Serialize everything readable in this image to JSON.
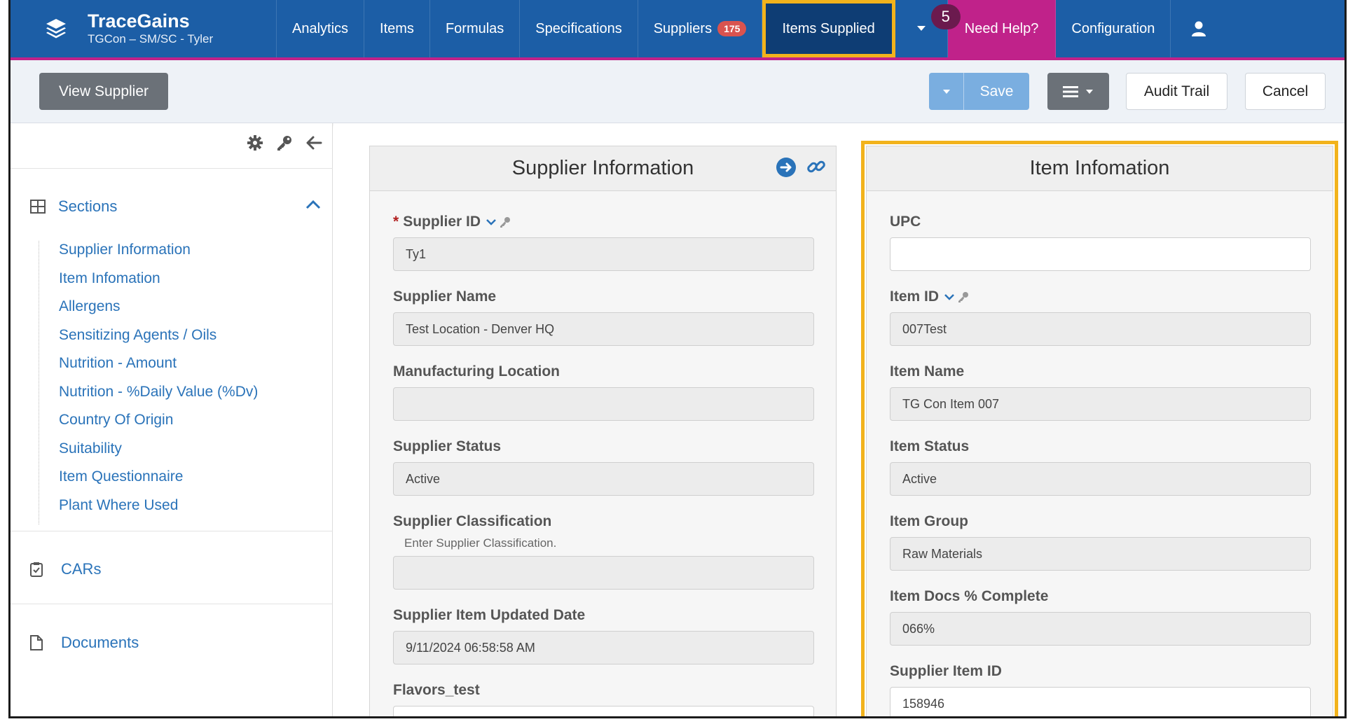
{
  "nav": {
    "brand_title": "TraceGains",
    "brand_sub": "TGCon – SM/SC - Tyler",
    "items": [
      "Analytics",
      "Items",
      "Formulas",
      "Specifications"
    ],
    "suppliers_label": "Suppliers",
    "suppliers_badge": "175",
    "active_label": "Items Supplied",
    "help_label": "Need Help?",
    "help_count": "5",
    "config_label": "Configuration",
    "accent": "#c0228a",
    "brand_color": "#1c5ea6"
  },
  "toolbar": {
    "view_supplier": "View Supplier",
    "save": "Save",
    "audit_trail": "Audit Trail",
    "cancel": "Cancel"
  },
  "sidebar": {
    "sections_label": "Sections",
    "sections": [
      "Supplier Information",
      "Item Infomation",
      "Allergens",
      "Sensitizing Agents / Oils",
      "Nutrition - Amount",
      "Nutrition - %Daily Value (%Dv)",
      "Country Of Origin",
      "Suitability",
      "Item Questionnaire",
      "Plant Where Used"
    ],
    "cars_label": "CARs",
    "documents_label": "Documents"
  },
  "supplier_panel": {
    "title": "Supplier Information",
    "supplier_id_label": "Supplier ID",
    "supplier_id": "Ty1",
    "supplier_name_label": "Supplier Name",
    "supplier_name": "Test Location - Denver HQ",
    "mfg_location_label": "Manufacturing Location",
    "mfg_location": "",
    "status_label": "Supplier Status",
    "status": "Active",
    "classification_label": "Supplier Classification",
    "classification_help": "Enter Supplier Classification.",
    "classification": "",
    "updated_label": "Supplier Item Updated Date",
    "updated": "9/11/2024 06:58:58 AM",
    "flavors_label": "Flavors_test"
  },
  "item_panel": {
    "title": "Item Infomation",
    "upc_label": "UPC",
    "upc": "",
    "item_id_label": "Item ID",
    "item_id": "007Test",
    "item_name_label": "Item Name",
    "item_name": "TG Con Item 007",
    "item_status_label": "Item Status",
    "item_status": "Active",
    "item_group_label": "Item Group",
    "item_group": "Raw Materials",
    "docs_label": "Item Docs % Complete",
    "docs": "066%",
    "supplier_item_id_label": "Supplier Item ID",
    "supplier_item_id": "158946"
  }
}
